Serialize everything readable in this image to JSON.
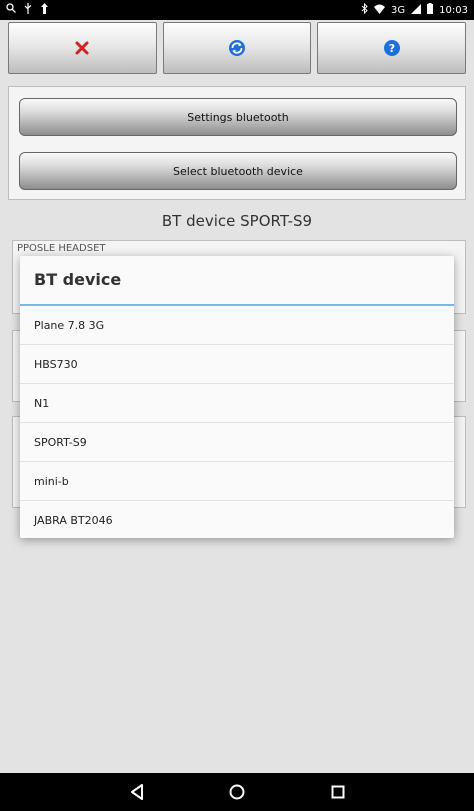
{
  "status_bar": {
    "time": "10:03",
    "network": "3G"
  },
  "toolbar": {
    "buttons": [
      {
        "icon": "close-icon",
        "color": "#d32020"
      },
      {
        "icon": "refresh-icon",
        "color": "#1e6fd9"
      },
      {
        "icon": "help-icon",
        "color": "#1e6fd9"
      }
    ]
  },
  "panel": {
    "settings_label": "Settings bluetooth",
    "select_label": "Select bluetooth device"
  },
  "bt_status": {
    "text": "BT device  SPORT-S9"
  },
  "background": {
    "partial_label": "PPOSLE HEADSET"
  },
  "dialog": {
    "title": "BT device",
    "items": [
      "Plane 7.8 3G",
      "HBS730",
      "N1",
      "SPORT-S9",
      "mini-b",
      "JABRA BT2046"
    ]
  }
}
